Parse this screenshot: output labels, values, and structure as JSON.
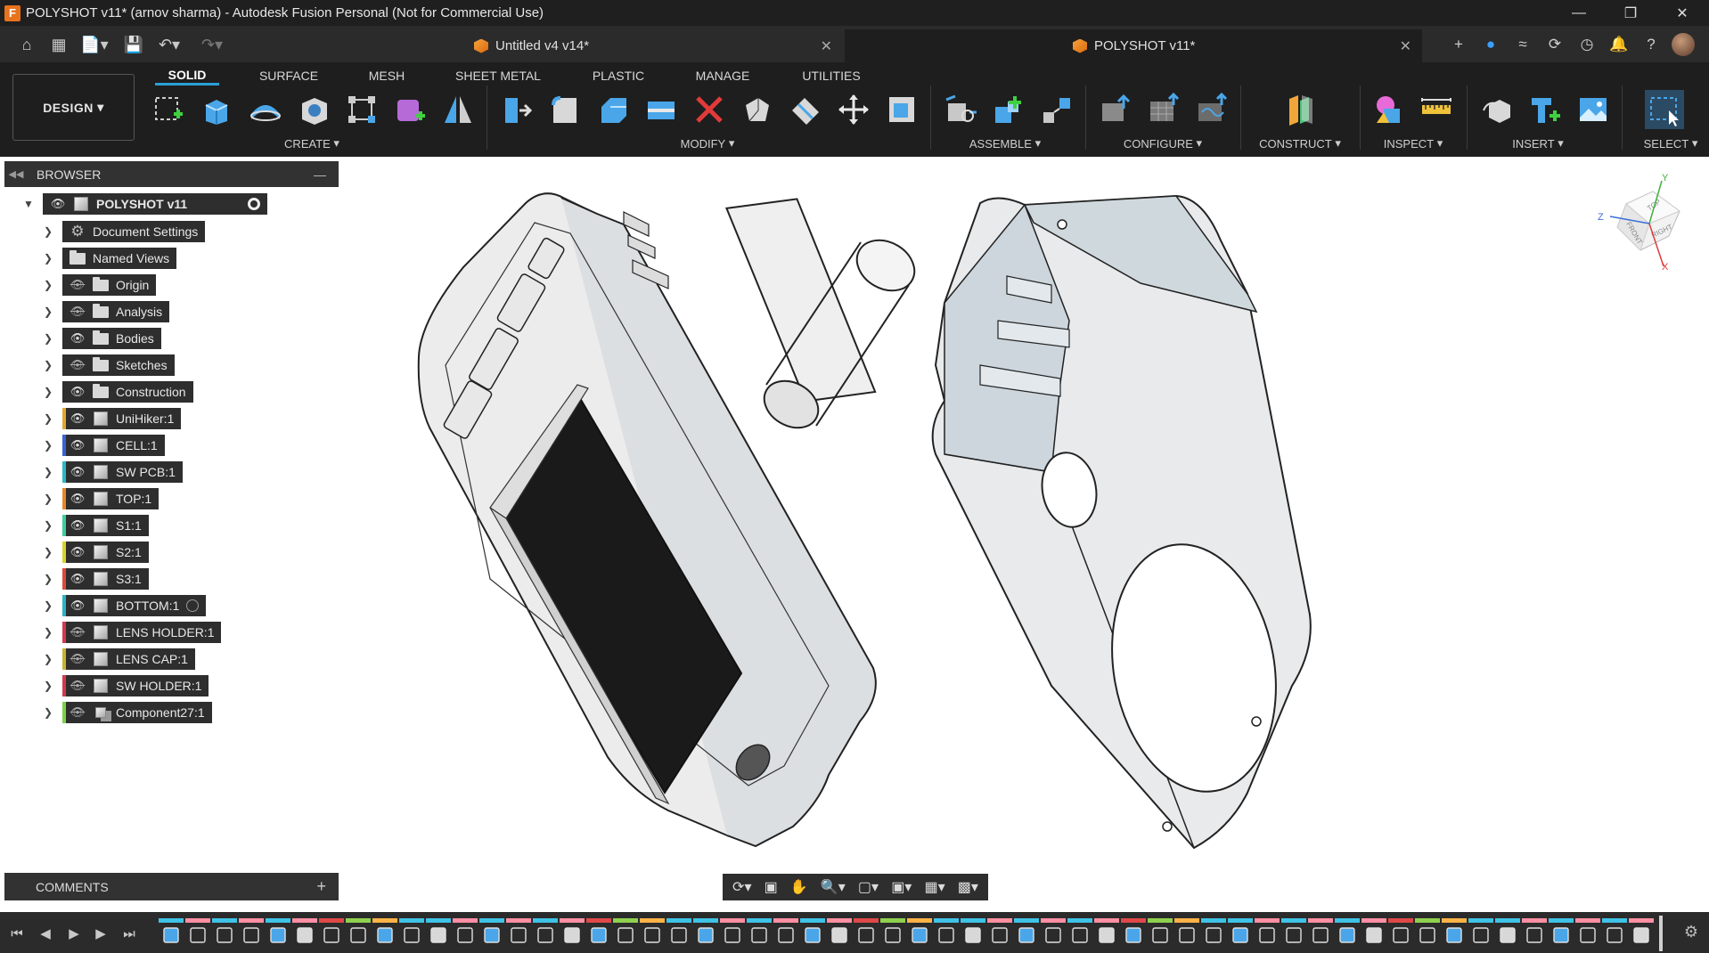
{
  "window": {
    "title": "POLYSHOT v11* (arnov sharma) - Autodesk Fusion Personal (Not for Commercial Use)",
    "app_icon": "F",
    "controls": [
      "minimize",
      "restore",
      "close"
    ]
  },
  "tabs": [
    {
      "label": "Untitled v4 v14*",
      "active": false
    },
    {
      "label": "POLYSHOT v11*",
      "active": true
    }
  ],
  "toolbar": {
    "workspace_label": "DESIGN",
    "workspace_tabs": [
      "SOLID",
      "SURFACE",
      "MESH",
      "SHEET METAL",
      "PLASTIC",
      "MANAGE",
      "UTILITIES"
    ],
    "active_tab": "SOLID",
    "groups": [
      "CREATE",
      "MODIFY",
      "ASSEMBLE",
      "CONFIGURE",
      "CONSTRUCT",
      "INSPECT",
      "INSERT",
      "SELECT"
    ]
  },
  "browser": {
    "title": "BROWSER",
    "root": "POLYSHOT v11",
    "items": [
      {
        "label": "Document Settings",
        "type": "settings",
        "visible": null,
        "color": ""
      },
      {
        "label": "Named Views",
        "type": "folder",
        "visible": null,
        "color": ""
      },
      {
        "label": "Origin",
        "type": "folder",
        "visible": false,
        "color": ""
      },
      {
        "label": "Analysis",
        "type": "folder",
        "visible": false,
        "color": ""
      },
      {
        "label": "Bodies",
        "type": "folder",
        "visible": true,
        "color": ""
      },
      {
        "label": "Sketches",
        "type": "folder",
        "visible": false,
        "color": ""
      },
      {
        "label": "Construction",
        "type": "folder",
        "visible": true,
        "color": ""
      },
      {
        "label": "UniHiker:1",
        "type": "component",
        "visible": true,
        "color": "#e0a82e"
      },
      {
        "label": "CELL:1",
        "type": "component",
        "visible": true,
        "color": "#3b62d6"
      },
      {
        "label": "SW PCB:1",
        "type": "component",
        "visible": true,
        "color": "#2db7c9"
      },
      {
        "label": "TOP:1",
        "type": "component",
        "visible": true,
        "color": "#e8882a"
      },
      {
        "label": "S1:1",
        "type": "component",
        "visible": true,
        "color": "#3ccf9a"
      },
      {
        "label": "S2:1",
        "type": "component",
        "visible": true,
        "color": "#d9d32a"
      },
      {
        "label": "S3:1",
        "type": "component",
        "visible": true,
        "color": "#e0473a"
      },
      {
        "label": "BOTTOM:1",
        "type": "component",
        "visible": true,
        "color": "#2bb3c7"
      },
      {
        "label": "LENS HOLDER:1",
        "type": "component",
        "visible": false,
        "color": "#d6384f"
      },
      {
        "label": "LENS CAP:1",
        "type": "component",
        "visible": false,
        "color": "#c9b230"
      },
      {
        "label": "SW HOLDER:1",
        "type": "component",
        "visible": false,
        "color": "#d6384f"
      },
      {
        "label": "Component27:1",
        "type": "assembly",
        "visible": false,
        "color": "#7bd147"
      }
    ]
  },
  "comments": {
    "title": "COMMENTS"
  },
  "viewcube": {
    "faces": [
      "TOP",
      "FRONT",
      "RIGHT"
    ],
    "axes": [
      "Y",
      "Z",
      "X"
    ]
  },
  "colors": {
    "accent": "#2a9fd6",
    "titlebar": "#1f1f1f",
    "toolbar": "#1e1e1e",
    "panel": "#323232"
  }
}
